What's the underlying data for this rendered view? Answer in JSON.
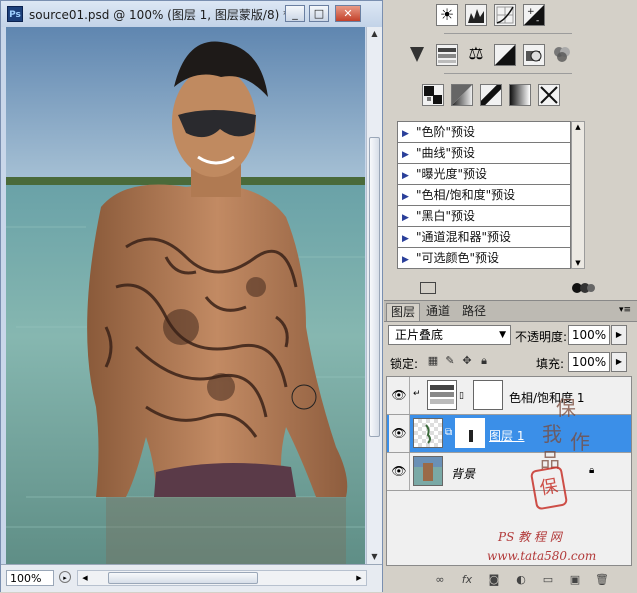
{
  "document": {
    "title": "source01.psd @ 100% (图层 1, 图层蒙版/8) *",
    "app_badge": "Ps",
    "zoom": "100%",
    "window_buttons": [
      "_",
      "□",
      "✕"
    ]
  },
  "adjustments": {
    "presets": [
      "\"色阶\"预设",
      "\"曲线\"预设",
      "\"曝光度\"预设",
      "\"色相/饱和度\"预设",
      "\"黑白\"预设",
      "\"通道混和器\"预设",
      "\"可选颜色\"预设"
    ]
  },
  "layers_panel": {
    "tabs": [
      "图层",
      "通道",
      "路径"
    ],
    "blend_mode": "正片叠底",
    "opacity_label": "不透明度:",
    "opacity_value": "100%",
    "lock_label": "锁定:",
    "fill_label": "填充:",
    "fill_value": "100%",
    "layers": [
      {
        "name": "色相/饱和度 1",
        "selected": false
      },
      {
        "name": "图层 1",
        "selected": true
      },
      {
        "name": "背景",
        "selected": false
      }
    ]
  },
  "watermark": {
    "chars": [
      "保",
      "我",
      "作",
      "品"
    ],
    "seal": "保",
    "site": "PS 教 程 网",
    "url": "www.tata580.com"
  },
  "colors": {
    "selection": "#3b8fe8",
    "panel_bg": "#d4d0c8",
    "seal_red": "#c8322a"
  }
}
